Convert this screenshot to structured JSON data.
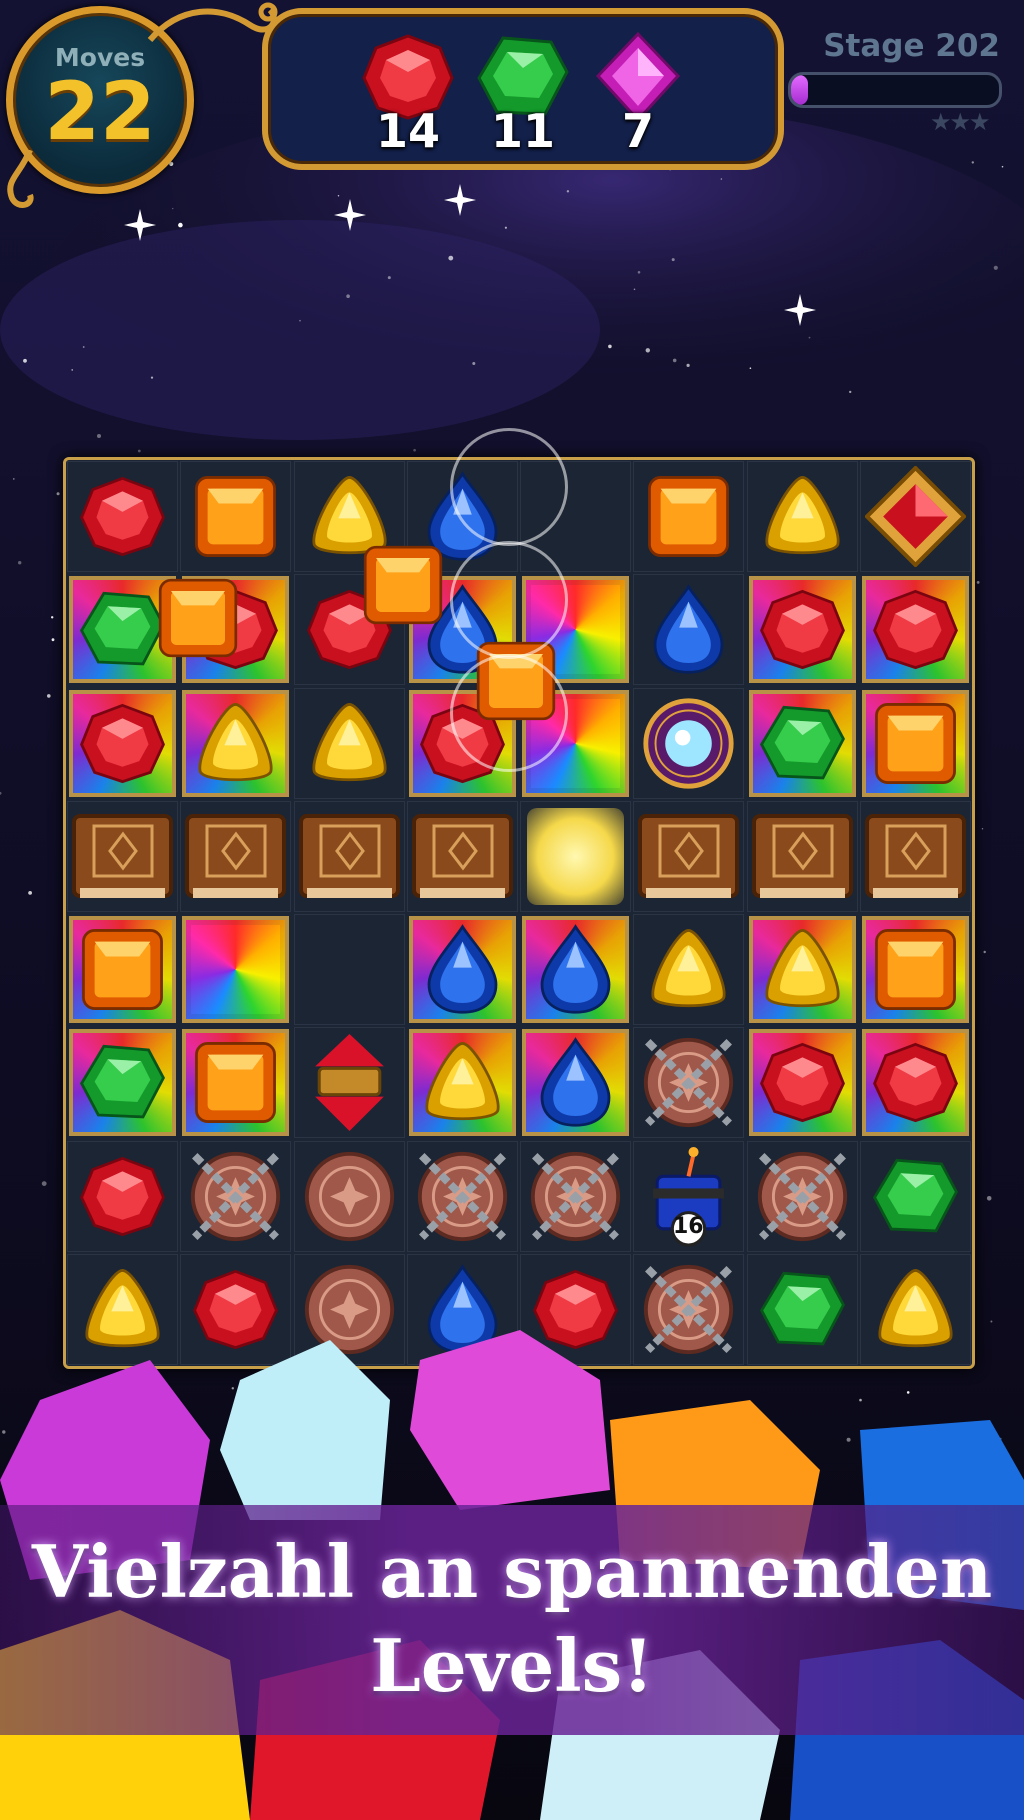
{
  "hud": {
    "moves_label": "Moves",
    "moves_value": "22",
    "stage_label": "Stage 202",
    "progress": 0.08,
    "stars_earned": 0,
    "stars_total": 3,
    "goals": [
      {
        "gem": "red",
        "count": "14"
      },
      {
        "gem": "green",
        "count": "11"
      },
      {
        "gem": "purple",
        "count": "7"
      }
    ]
  },
  "board": {
    "rows": 8,
    "cols": 8,
    "cells": [
      [
        "red",
        "orange",
        "yellow",
        "blue",
        "empty",
        "orange",
        "yellow",
        "framed-red"
      ],
      [
        "t:green",
        "t:red",
        "red",
        "t:blue",
        "t:rainbow",
        "blue",
        "t:red",
        "t:red"
      ],
      [
        "t:red",
        "t:yellow",
        "yellow",
        "t:red",
        "t:rainbow",
        "orb",
        "t:green",
        "t:orange"
      ],
      [
        "book",
        "book",
        "book",
        "book",
        "glow",
        "book",
        "book",
        "book"
      ],
      [
        "t:orange",
        "t:rainbow",
        "empty",
        "t:blue",
        "t:blue",
        "yellow",
        "t:yellow",
        "t:orange"
      ],
      [
        "t:green",
        "t:orange",
        "spinner",
        "t:yellow",
        "t:blue",
        "chain",
        "t:red",
        "t:red"
      ],
      [
        "red",
        "chain",
        "coin",
        "chain",
        "chain",
        "dynamite",
        "chain",
        "green"
      ],
      [
        "yellow",
        "red",
        "coin",
        "blue",
        "red",
        "chain",
        "green",
        "yellow"
      ]
    ],
    "dynamite_counter": "16"
  },
  "caption": {
    "line1": "Vielzahl an spannenden",
    "line2": "Levels!"
  },
  "colors": {
    "red": "#e0142a",
    "orange": "#ff8a00",
    "yellow": "#f6c514",
    "blue": "#1a56d9",
    "green": "#1fb33a",
    "purple": "#d331c9",
    "gold_frame": "#c9a04a"
  }
}
